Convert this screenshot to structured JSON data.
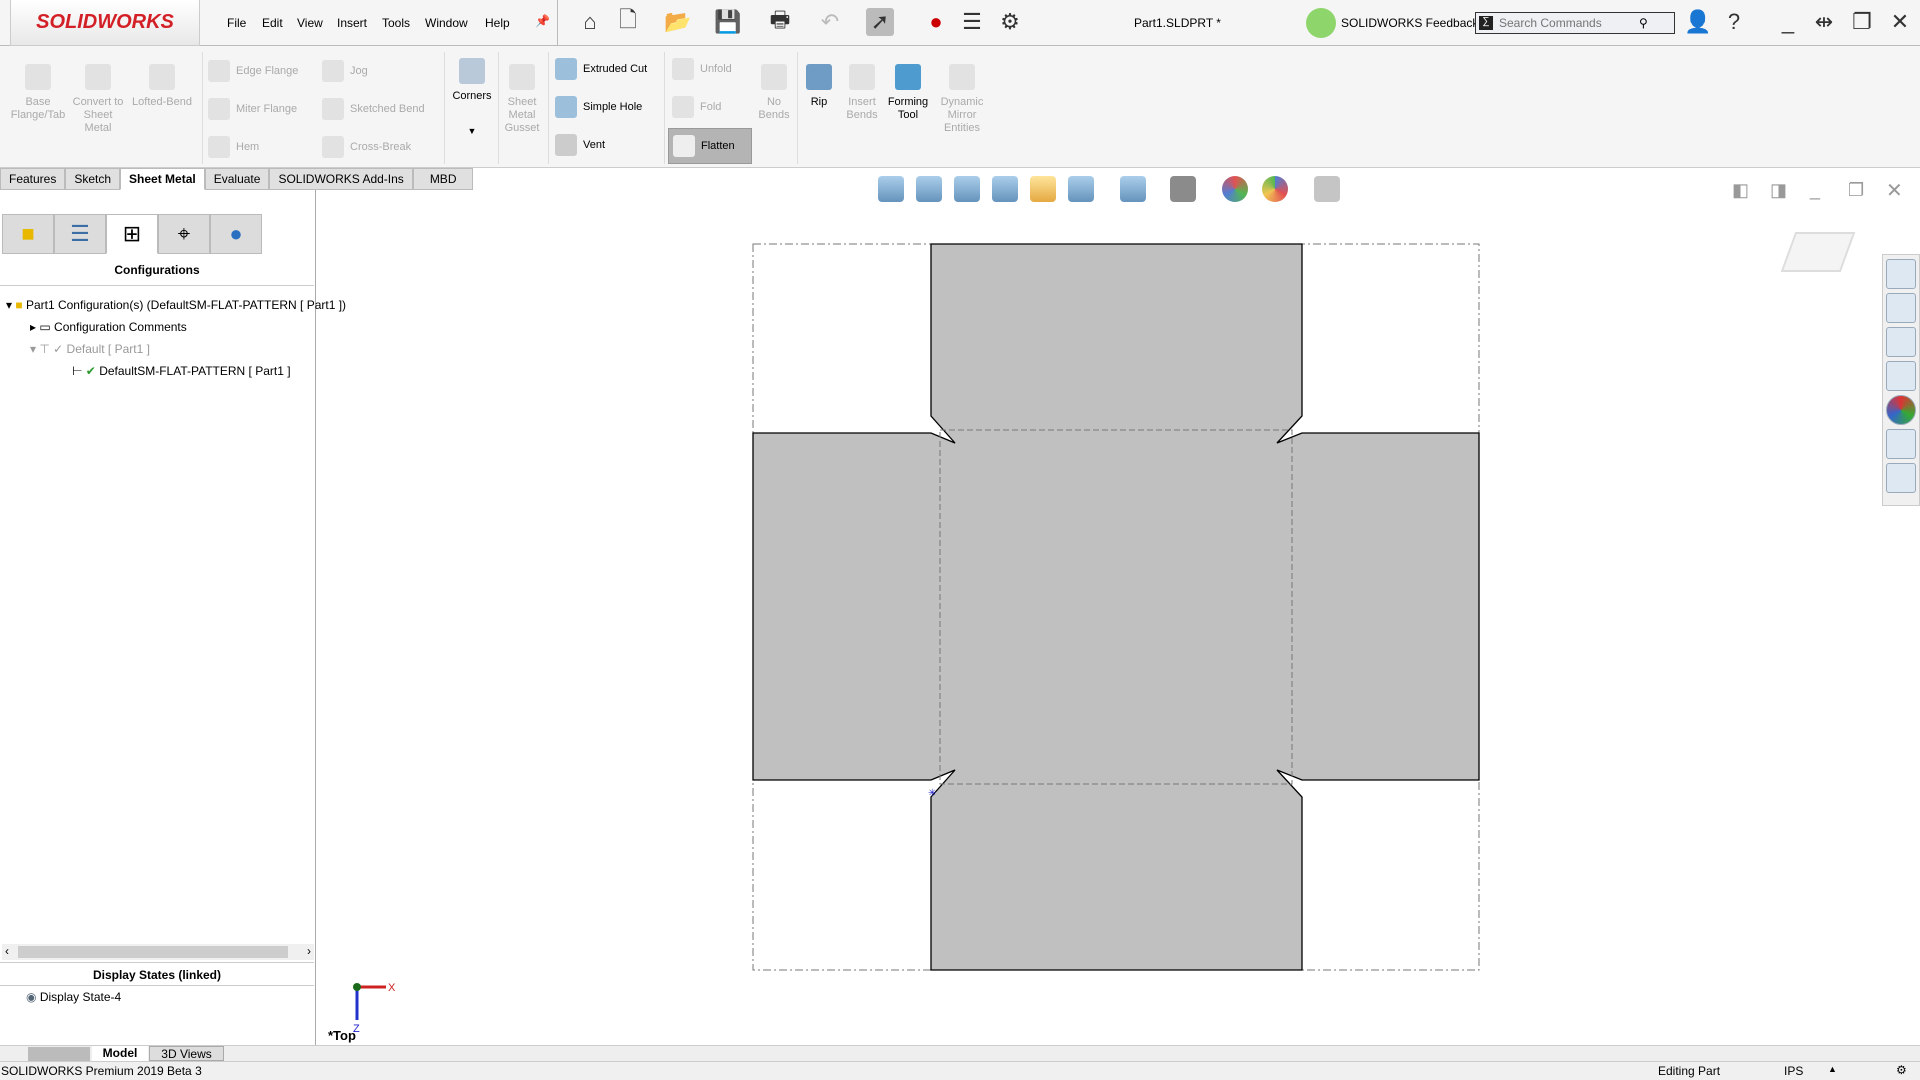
{
  "app": {
    "logo": "SOLIDWORKS",
    "doc_title": "Part1.SLDPRT *",
    "feedback": "SOLIDWORKS Feedback",
    "search_placeholder": "Search Commands"
  },
  "menu": [
    "File",
    "Edit",
    "View",
    "Insert",
    "Tools",
    "Window",
    "Help"
  ],
  "ribbon": {
    "base_flange": "Base Flange/Tab",
    "convert": "Convert to Sheet Metal",
    "lofted": "Lofted-Bend",
    "edge_flange": "Edge Flange",
    "miter_flange": "Miter Flange",
    "hem": "Hem",
    "jog": "Jog",
    "sketched_bend": "Sketched Bend",
    "cross_break": "Cross-Break",
    "corners": "Corners",
    "gusset": "Sheet Metal Gusset",
    "extruded_cut": "Extruded Cut",
    "simple_hole": "Simple Hole",
    "vent": "Vent",
    "unfold": "Unfold",
    "fold": "Fold",
    "flatten": "Flatten",
    "no_bends": "No Bends",
    "rip": "Rip",
    "insert_bends": "Insert Bends",
    "forming_tool": "Forming Tool",
    "dynamic_mirror": "Dynamic Mirror Entities"
  },
  "tabs": [
    "Features",
    "Sketch",
    "Sheet Metal",
    "Evaluate",
    "SOLIDWORKS Add-Ins",
    "MBD"
  ],
  "active_tab": "Sheet Metal",
  "panel": {
    "title": "Configurations",
    "tree": [
      "Part1 Configuration(s)  (DefaultSM-FLAT-PATTERN [ Part1 ])",
      "Configuration Comments",
      "Default [ Part1 ]",
      "DefaultSM-FLAT-PATTERN [ Part1 ]"
    ],
    "display_states_title": "Display States (linked)",
    "display_state": "Display State-4"
  },
  "viewport": {
    "view_label": "*Top",
    "axis_x": "X",
    "axis_z": "Z",
    "part_fill": "#c0c0c0"
  },
  "bottom_tabs": [
    "Model",
    "3D Views"
  ],
  "status": {
    "left": "SOLIDWORKS Premium 2019 Beta 3",
    "mode": "Editing Part",
    "units": "IPS"
  }
}
